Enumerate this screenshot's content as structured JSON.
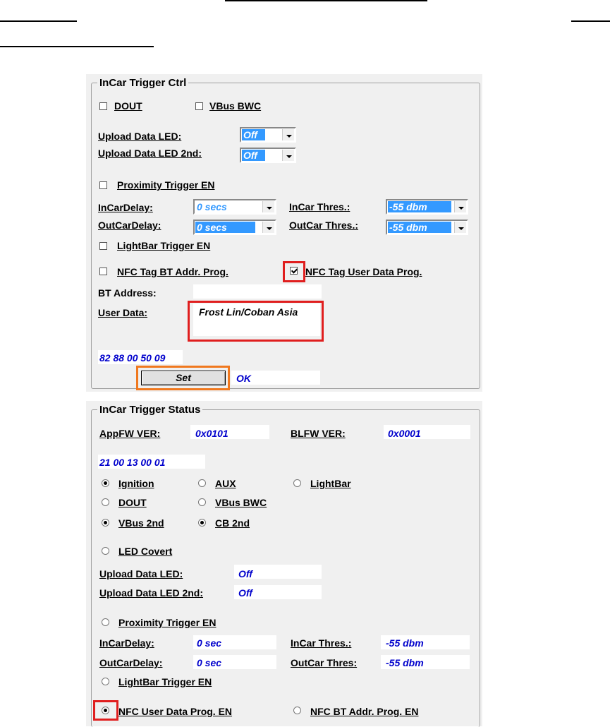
{
  "ctrl": {
    "title": "InCar Trigger Ctrl",
    "dout_label": "DOUT",
    "vbus_bwc_label": "VBus BWC",
    "upload_led_label": "Upload Data LED:",
    "upload_led_value": "Off",
    "upload_led2_label": "Upload Data LED 2nd:",
    "upload_led2_value": "Off",
    "proximity_label": "Proximity Trigger EN",
    "incar_delay_label": "InCarDelay:",
    "incar_delay_value": "0 secs",
    "incar_thres_label": "InCar Thres.:",
    "incar_thres_value": "-55 dbm",
    "outcar_delay_label": "OutCarDelay:",
    "outcar_delay_value": "0 secs",
    "outcar_thres_label": "OutCar Thres.:",
    "outcar_thres_value": "-55 dbm",
    "lightbar_label": "LightBar Trigger EN",
    "nfc_bt_label": "NFC Tag BT Addr. Prog.",
    "nfc_user_label": "NFC Tag User Data Prog.",
    "nfc_user_checked": true,
    "bt_address_label": "BT Address:",
    "bt_address_value": "",
    "user_data_label": "User Data:",
    "user_data_value": "Frost Lin/Coban Asia",
    "hex_value": "82 88 00 50 09",
    "set_button": "Set",
    "status_text": "OK"
  },
  "status": {
    "title": "InCar Trigger Status",
    "appfw_label": "AppFW VER:",
    "appfw_value": "0x0101",
    "blfw_label": "BLFW VER:",
    "blfw_value": "0x0001",
    "hex_value": "21 00 13 00 01",
    "ignition_label": "Ignition",
    "aux_label": "AUX",
    "lightbar_label": "LightBar",
    "dout_label": "DOUT",
    "vbus_bwc_label": "VBus BWC",
    "vbus2_label": "VBus 2nd",
    "cb2_label": "CB 2nd",
    "led_covert_label": "LED Covert",
    "upload_led_label": "Upload Data LED:",
    "upload_led_value": "Off",
    "upload_led2_label": "Upload Data LED 2nd:",
    "upload_led2_value": "Off",
    "proximity_label": "Proximity Trigger EN",
    "incar_delay_label": "InCarDelay:",
    "incar_delay_value": "0 sec",
    "incar_thres_label": "InCar Thres.:",
    "incar_thres_value": "-55 dbm",
    "outcar_delay_label": "OutCarDelay:",
    "outcar_delay_value": "0 sec",
    "outcar_thres_label": "OutCar Thres:",
    "outcar_thres_value": "-55 dbm",
    "lightbar_trigger_label": "LightBar Trigger EN",
    "nfc_user_label": "NFC User Data Prog. EN",
    "nfc_bt_label": "NFC BT Addr. Prog. EN"
  },
  "colors": {
    "highlight_red": "#e01e1e",
    "highlight_orange": "#f0781e",
    "value_blue": "#0000cc",
    "selection_blue": "#3399ff"
  }
}
